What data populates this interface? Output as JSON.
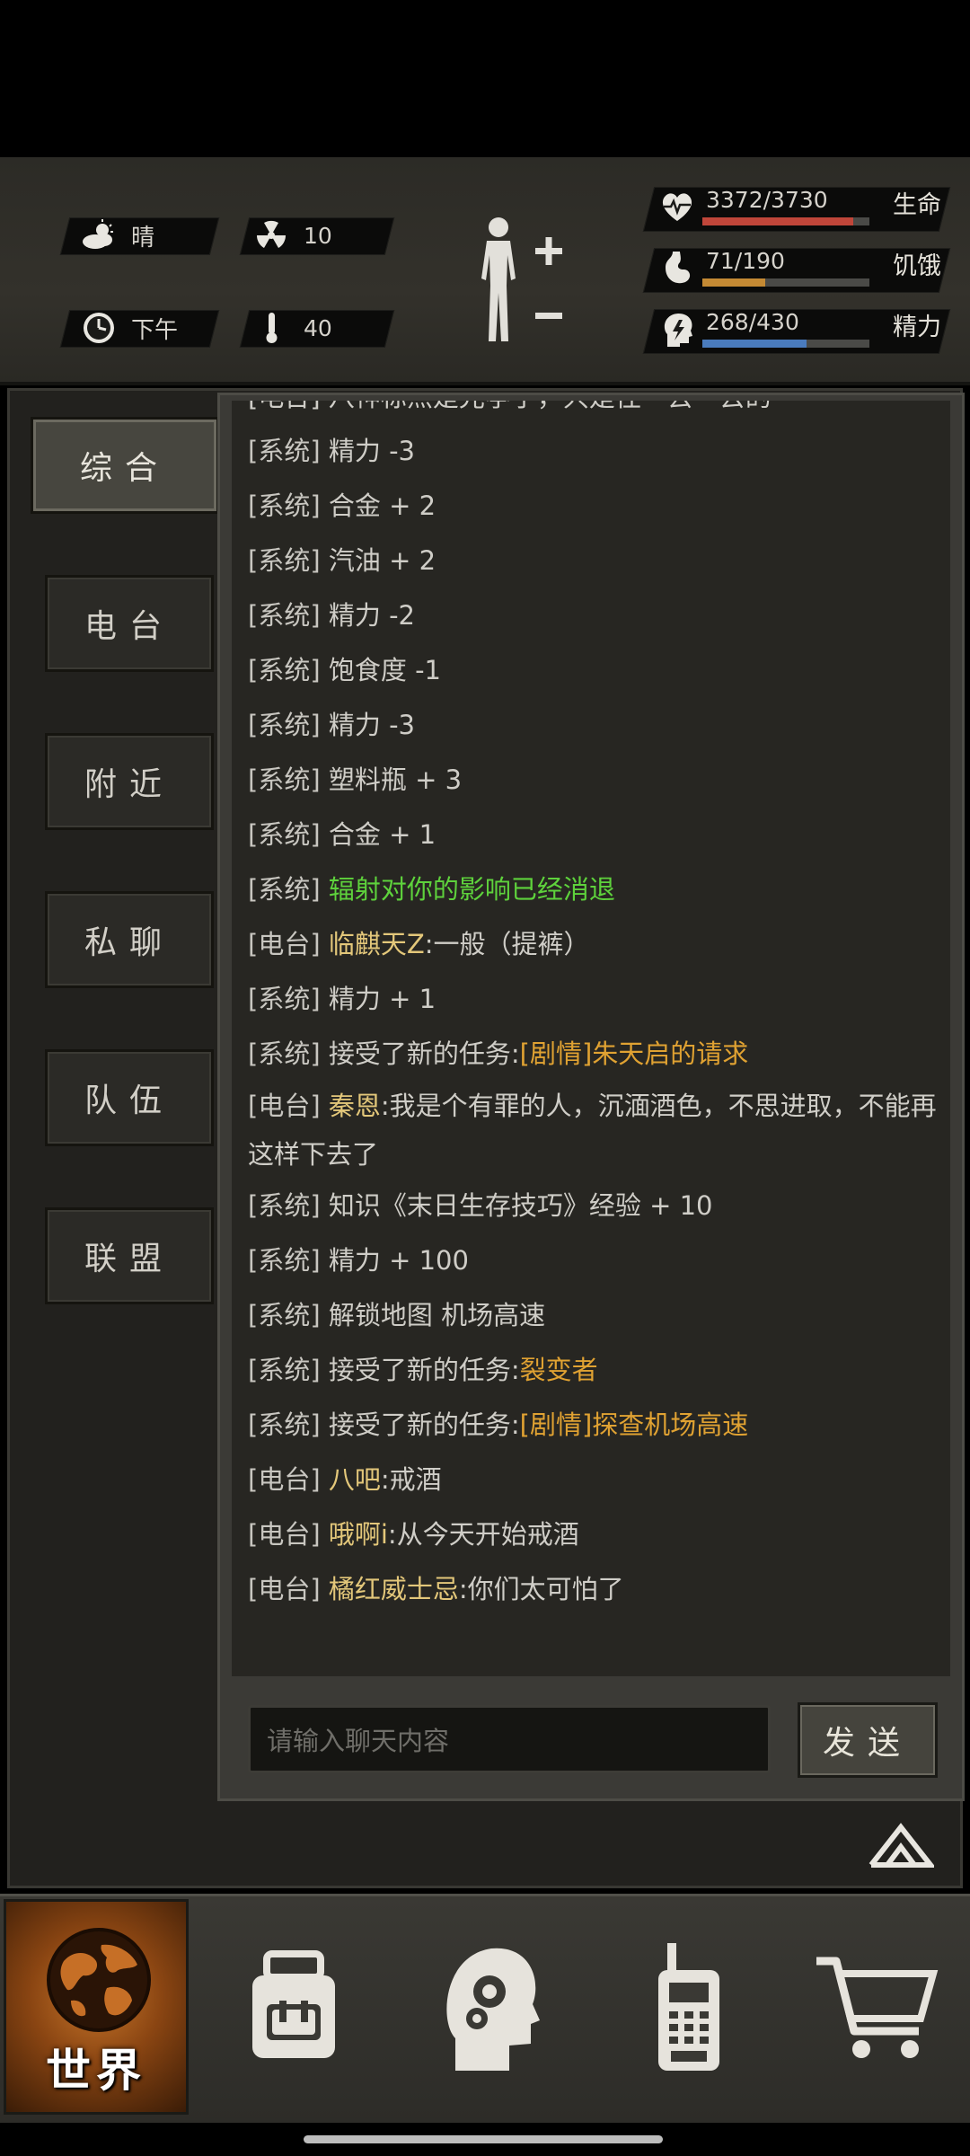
{
  "status": {
    "weather": "晴",
    "radiation": "10",
    "time_of_day": "下午",
    "temperature": "40",
    "health": {
      "value": "3372/3730",
      "label": "生命",
      "fraction": 0.904,
      "color": "#c0463a"
    },
    "hunger": {
      "value": "71/190",
      "label": "饥饿",
      "fraction": 0.374,
      "color": "#c48a34"
    },
    "energy": {
      "value": "268/430",
      "label": "精力",
      "fraction": 0.623,
      "color": "#4a7bbd"
    }
  },
  "sidebar": {
    "tabs": [
      {
        "label": "综合"
      },
      {
        "label": "电台"
      },
      {
        "label": "附近"
      },
      {
        "label": "私聊"
      },
      {
        "label": "队伍"
      },
      {
        "label": "联盟"
      }
    ]
  },
  "chat": {
    "cut_off_line": "[电台] 八神标杰是光亭子，只是往一去一去的",
    "messages": [
      {
        "channel": "[系统]",
        "name": "",
        "text": "精力 -3",
        "style": "plain"
      },
      {
        "channel": "[系统]",
        "name": "",
        "text": "合金 + 2",
        "style": "plain"
      },
      {
        "channel": "[系统]",
        "name": "",
        "text": "汽油 + 2",
        "style": "plain"
      },
      {
        "channel": "[系统]",
        "name": "",
        "text": "精力 -2",
        "style": "plain"
      },
      {
        "channel": "[系统]",
        "name": "",
        "text": "饱食度 -1",
        "style": "plain"
      },
      {
        "channel": "[系统]",
        "name": "",
        "text": "精力 -3",
        "style": "plain"
      },
      {
        "channel": "[系统]",
        "name": "",
        "text": "塑料瓶 + 3",
        "style": "plain"
      },
      {
        "channel": "[系统]",
        "name": "",
        "text": "合金 + 1",
        "style": "plain"
      },
      {
        "channel": "[系统]",
        "name": "",
        "text": "辐射对你的影响已经消退",
        "style": "green"
      },
      {
        "channel": "[电台]",
        "name": "临麒天Z",
        "text": ":一般（提裤）",
        "style": "radio"
      },
      {
        "channel": "[系统]",
        "name": "",
        "text": "精力 + 1",
        "style": "plain"
      },
      {
        "channel": "[系统]",
        "name": "",
        "text": "接受了新的任务:",
        "highlight": "[剧情]朱天启的请求",
        "style": "quest"
      },
      {
        "channel": "[电台]",
        "name": "秦恩",
        "text": ":我是个有罪的人，沉湎酒色，不思进取，不能再这样下去了",
        "style": "radio-wrap"
      },
      {
        "channel": "[系统]",
        "name": "",
        "text": "知识《末日生存技巧》经验 + 10",
        "style": "plain"
      },
      {
        "channel": "[系统]",
        "name": "",
        "text": "精力 + 100",
        "style": "plain"
      },
      {
        "channel": "[系统]",
        "name": "",
        "text": "解锁地图 机场高速",
        "style": "plain"
      },
      {
        "channel": "[系统]",
        "name": "",
        "text": "接受了新的任务:",
        "highlight": "裂变者",
        "style": "quest"
      },
      {
        "channel": "[系统]",
        "name": "",
        "text": "接受了新的任务:",
        "highlight": "[剧情]探查机场高速",
        "style": "quest"
      },
      {
        "channel": "[电台]",
        "name": "八吧",
        "text": ":戒酒",
        "style": "radio"
      },
      {
        "channel": "[电台]",
        "name": "哦啊i",
        "text": ":从今天开始戒酒",
        "style": "radio"
      },
      {
        "channel": "[电台]",
        "name": "橘红威士忌",
        "text": ":你们太可怕了",
        "style": "radio"
      }
    ],
    "input_placeholder": "请输入聊天内容",
    "send_label": "发送"
  },
  "bottom_nav": {
    "world_label": "世界",
    "items": [
      {
        "icon": "backpack-icon"
      },
      {
        "icon": "skills-head-icon"
      },
      {
        "icon": "walkie-talkie-icon"
      },
      {
        "icon": "shopping-cart-icon"
      }
    ]
  }
}
